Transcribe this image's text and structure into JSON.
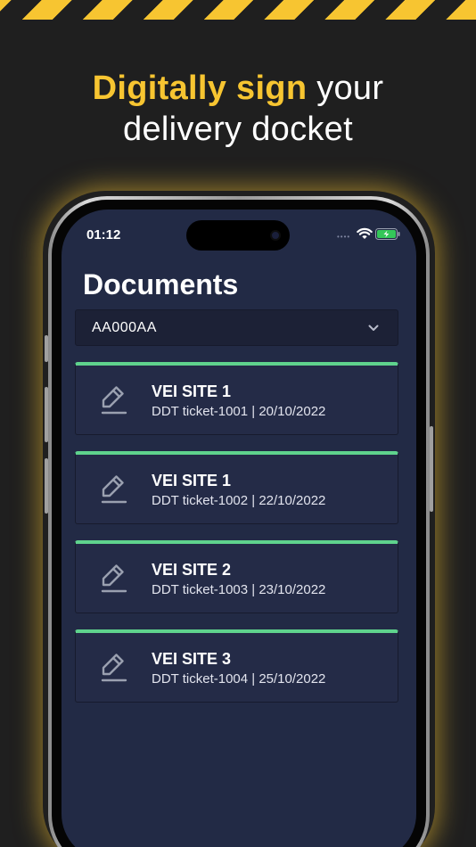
{
  "headline": {
    "accent": "Digitally sign",
    "rest_line1": " your",
    "line2": "delivery docket"
  },
  "status_bar": {
    "time": "01:12",
    "signal_dots": "••••",
    "wifi_icon": "wifi-icon",
    "battery_icon": "battery-charging-icon"
  },
  "screen": {
    "title": "Documents",
    "vehicle_select": {
      "value": "AA000AA",
      "icon": "chevron-down-icon"
    },
    "documents": [
      {
        "site": "VEI SITE 1",
        "meta": "DDT ticket-1001 | 20/10/2022",
        "icon": "pencil-sign-icon"
      },
      {
        "site": "VEI SITE 1",
        "meta": "DDT ticket-1002 | 22/10/2022",
        "icon": "pencil-sign-icon"
      },
      {
        "site": "VEI SITE 2",
        "meta": "DDT ticket-1003 | 23/10/2022",
        "icon": "pencil-sign-icon"
      },
      {
        "site": "VEI SITE 3",
        "meta": "DDT ticket-1004 | 25/10/2022",
        "icon": "pencil-sign-icon"
      }
    ]
  },
  "colors": {
    "accent_yellow": "#f7c531",
    "background": "#1f1f1f",
    "screen_bg": "#222a45",
    "card_bg": "#242b47",
    "card_top_border": "#5fd38d",
    "battery_green": "#34c759"
  }
}
